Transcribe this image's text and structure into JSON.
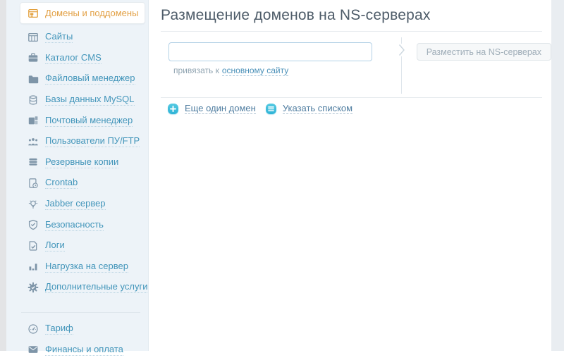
{
  "colors": {
    "accent_orange": "#e2a044",
    "sidebar_bg": "#edf3f8",
    "sidebar_link": "#4295ba",
    "content_link": "#4a90b8",
    "bottom_link": "#4f7da0",
    "cyan_icon": "#3bbcdb",
    "title_text": "#4e5c69",
    "muted_text": "#90a4b1",
    "disabled_button_text": "#9fadb8",
    "input_border": "#b3d1e6"
  },
  "sidebar": {
    "items": [
      {
        "label": "Домены и поддомены",
        "icon": "domains-window",
        "active": true
      },
      {
        "label": "Сайты",
        "icon": "site-window",
        "active": false
      },
      {
        "label": "Каталог CMS",
        "icon": "briefcase",
        "active": false
      },
      {
        "label": "Файловый менеджер",
        "icon": "folder",
        "active": false
      },
      {
        "label": "Базы данных MySQL",
        "icon": "database",
        "active": false
      },
      {
        "label": "Почтовый менеджер",
        "icon": "mailbox",
        "active": false
      },
      {
        "label": "Пользователи ПУ/FTP",
        "icon": "users",
        "active": false
      },
      {
        "label": "Резервные копии",
        "icon": "stack",
        "active": false
      },
      {
        "label": "Crontab",
        "icon": "document-clock",
        "active": false
      },
      {
        "label": "Jabber сервер",
        "icon": "lightbulb",
        "active": false
      },
      {
        "label": "Безопасность",
        "icon": "shield",
        "active": false
      },
      {
        "label": "Логи",
        "icon": "document-check",
        "active": false
      },
      {
        "label": "Нагрузка на сервер",
        "icon": "bar-chart",
        "active": false
      },
      {
        "label": "Дополнительные услуги",
        "icon": "gear-check",
        "active": false
      }
    ],
    "footer_items": [
      {
        "label": "Тариф",
        "icon": "gauge"
      },
      {
        "label": "Финансы и оплата",
        "icon": "envelope"
      }
    ]
  },
  "main": {
    "title": "Размещение доменов на NS-серверах",
    "input_value": "",
    "bind_prefix": "привязать к",
    "bind_link_label": "основному сайту",
    "submit_button": "Разместить на NS-серверах",
    "add_domain_label": "Еще один домен",
    "list_label": "Указать списком"
  }
}
